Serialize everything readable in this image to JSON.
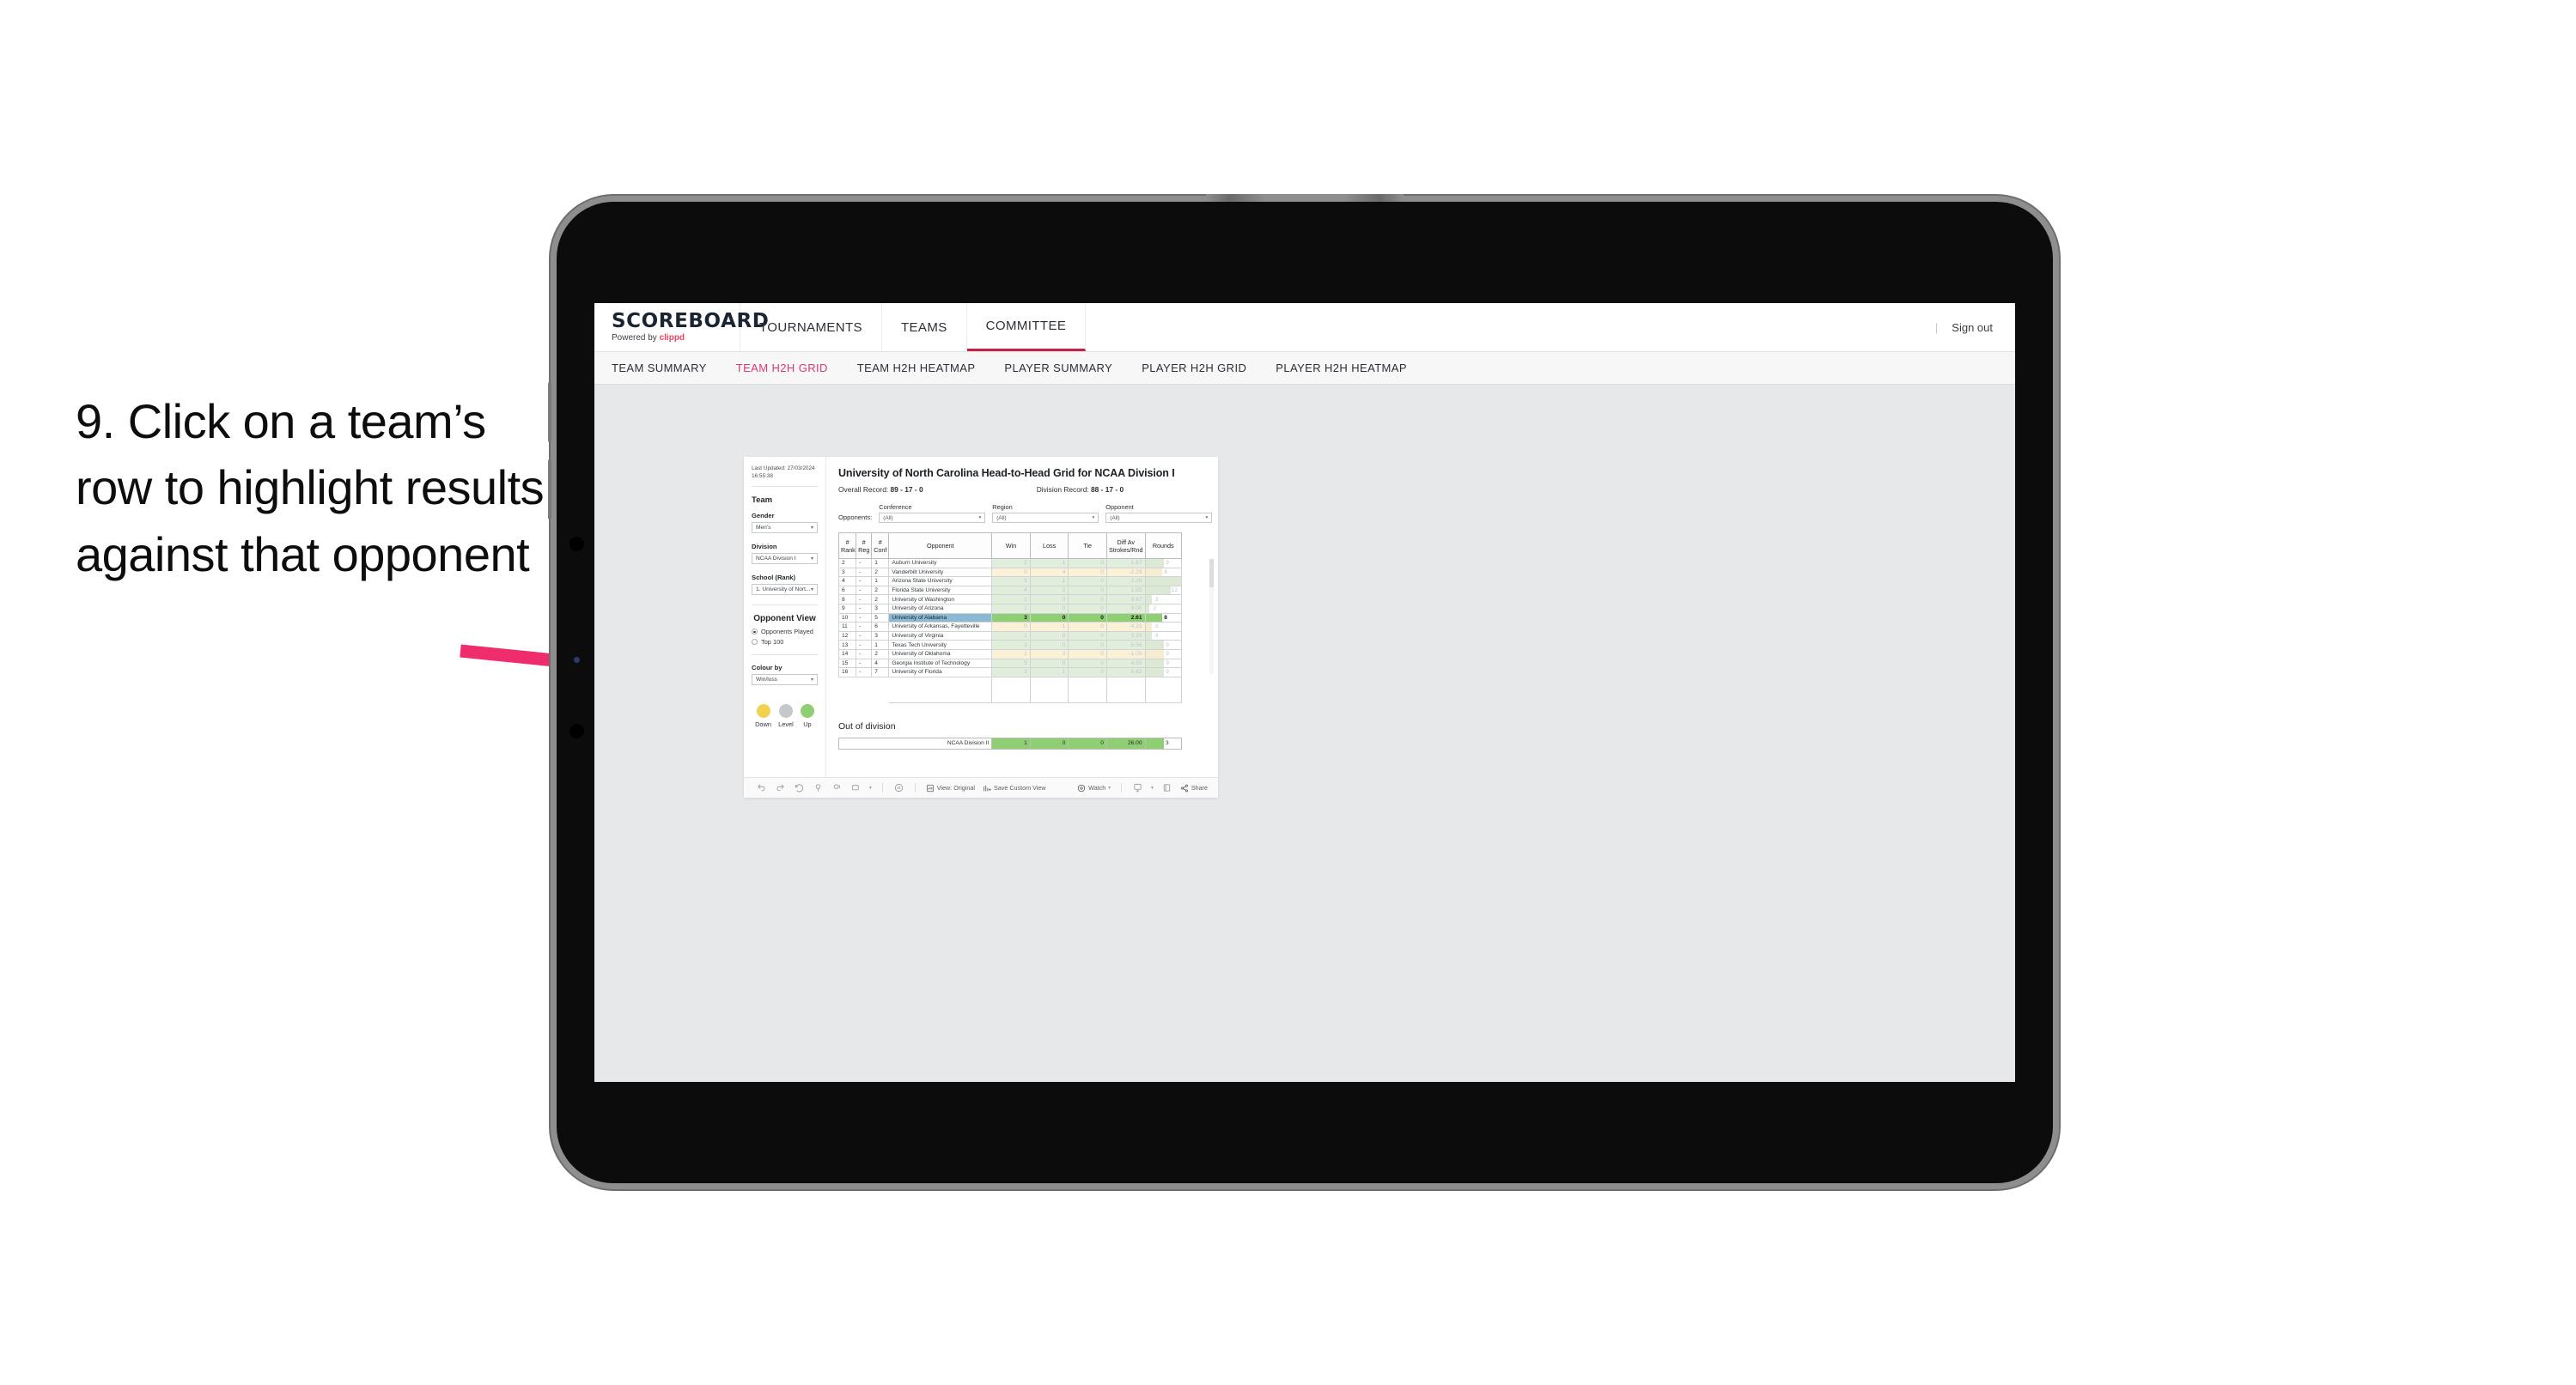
{
  "annotation": {
    "text": "9. Click on a team’s row to highlight results against that opponent",
    "arrow_color": "#ef2d6d"
  },
  "topnav": {
    "brand_title": "SCOREBOARD",
    "brand_sub_prefix": "Powered by ",
    "brand_sub_accent": "clippd",
    "items": [
      {
        "label": "TOURNAMENTS",
        "active": false
      },
      {
        "label": "TEAMS",
        "active": false
      },
      {
        "label": "COMMITTEE",
        "active": true
      }
    ],
    "divider": "|",
    "sign_out": "Sign out"
  },
  "subnav": {
    "items": [
      {
        "label": "TEAM SUMMARY",
        "active": false
      },
      {
        "label": "TEAM H2H GRID",
        "active": true
      },
      {
        "label": "TEAM H2H HEATMAP",
        "active": false
      },
      {
        "label": "PLAYER SUMMARY",
        "active": false
      },
      {
        "label": "PLAYER H2H GRID",
        "active": false
      },
      {
        "label": "PLAYER H2H HEATMAP",
        "active": false
      }
    ]
  },
  "sidebar": {
    "last_updated": "Last Updated: 27/03/2024 16:55:38",
    "team_title": "Team",
    "gender_label": "Gender",
    "gender_value": "Men’s",
    "division_label": "Division",
    "division_value": "NCAA Division I",
    "school_label": "School (Rank)",
    "school_value": "1. University of Nort...",
    "opponent_view_title": "Opponent View",
    "opponent_view_options": [
      {
        "label": "Opponents Played",
        "checked": true
      },
      {
        "label": "Top 100",
        "checked": false
      }
    ],
    "colour_by_label": "Colour by",
    "colour_by_value": "Win/loss",
    "legend": [
      {
        "label": "Down",
        "color": "#f2d14e"
      },
      {
        "label": "Level",
        "color": "#c4c8cb"
      },
      {
        "label": "Up",
        "color": "#8fce72"
      }
    ]
  },
  "main": {
    "title": "University of North Carolina Head-to-Head Grid for NCAA Division I",
    "overall_record_label": "Overall Record:",
    "overall_record_value": "89 - 17 - 0",
    "division_record_label": "Division Record:",
    "division_record_value": "88 - 17 - 0",
    "opponents_label": "Opponents:",
    "filters": [
      {
        "label": "Conference",
        "value": "(All)"
      },
      {
        "label": "Region",
        "value": "(All)"
      },
      {
        "label": "Opponent",
        "value": "(All)"
      }
    ],
    "out_of_division_title": "Out of division"
  },
  "chart_data": {
    "type": "table",
    "title": "University of North Carolina Head-to-Head Grid for NCAA Division I",
    "columns": [
      "# Rank",
      "# Reg",
      "# Conf",
      "Opponent",
      "Win",
      "Loss",
      "Tie",
      "Diff Av Strokes/Rnd",
      "Rounds"
    ],
    "rounds_max": 17,
    "rows": [
      {
        "rank": "2",
        "reg": "-",
        "conf": "1",
        "opponent": "Auburn University",
        "win": "2",
        "loss": "1",
        "tie": "0",
        "diff": "1.67",
        "rounds": "9",
        "state": "up",
        "selected": false
      },
      {
        "rank": "3",
        "reg": "-",
        "conf": "2",
        "opponent": "Vanderbilt University",
        "win": "0",
        "loss": "4",
        "tie": "0",
        "diff": "-2.29",
        "rounds": "8",
        "state": "down",
        "selected": false
      },
      {
        "rank": "4",
        "reg": "-",
        "conf": "1",
        "opponent": "Arizona State University",
        "win": "5",
        "loss": "1",
        "tie": "0",
        "diff": "2.28",
        "rounds": "17",
        "state": "up",
        "selected": false
      },
      {
        "rank": "6",
        "reg": "-",
        "conf": "2",
        "opponent": "Florida State University",
        "win": "4",
        "loss": "2",
        "tie": "0",
        "diff": "1.83",
        "rounds": "12",
        "state": "up",
        "selected": false
      },
      {
        "rank": "8",
        "reg": "-",
        "conf": "2",
        "opponent": "University of Washington",
        "win": "1",
        "loss": "0",
        "tie": "0",
        "diff": "3.67",
        "rounds": "3",
        "state": "up",
        "selected": false
      },
      {
        "rank": "9",
        "reg": "-",
        "conf": "3",
        "opponent": "University of Arizona",
        "win": "1",
        "loss": "0",
        "tie": "0",
        "diff": "9.00",
        "rounds": "2",
        "state": "up",
        "selected": false
      },
      {
        "rank": "10",
        "reg": "-",
        "conf": "5",
        "opponent": "University of Alabama",
        "win": "3",
        "loss": "0",
        "tie": "0",
        "diff": "2.61",
        "rounds": "8",
        "state": "up",
        "selected": true
      },
      {
        "rank": "11",
        "reg": "-",
        "conf": "6",
        "opponent": "University of Arkansas, Fayetteville",
        "win": "0",
        "loss": "1",
        "tie": "0",
        "diff": "-4.33",
        "rounds": "3",
        "state": "down",
        "selected": false
      },
      {
        "rank": "12",
        "reg": "-",
        "conf": "3",
        "opponent": "University of Virginia",
        "win": "1",
        "loss": "0",
        "tie": "0",
        "diff": "2.33",
        "rounds": "3",
        "state": "up",
        "selected": false
      },
      {
        "rank": "13",
        "reg": "-",
        "conf": "1",
        "opponent": "Texas Tech University",
        "win": "3",
        "loss": "0",
        "tie": "0",
        "diff": "5.56",
        "rounds": "9",
        "state": "up",
        "selected": false
      },
      {
        "rank": "14",
        "reg": "-",
        "conf": "2",
        "opponent": "University of Oklahoma",
        "win": "1",
        "loss": "2",
        "tie": "0",
        "diff": "-1.00",
        "rounds": "9",
        "state": "down",
        "selected": false
      },
      {
        "rank": "15",
        "reg": "-",
        "conf": "4",
        "opponent": "Georgia Institute of Technology",
        "win": "5",
        "loss": "0",
        "tie": "0",
        "diff": "4.50",
        "rounds": "9",
        "state": "up",
        "selected": false
      },
      {
        "rank": "16",
        "reg": "-",
        "conf": "7",
        "opponent": "University of Florida",
        "win": "3",
        "loss": "1",
        "tie": "0",
        "diff": "6.62",
        "rounds": "9",
        "state": "up",
        "selected": false
      }
    ],
    "out_of_division": [
      {
        "label": "NCAA Division II",
        "win": "1",
        "loss": "0",
        "tie": "0",
        "diff": "26.00",
        "rounds": "3"
      }
    ]
  },
  "toolbar": {
    "icons": [
      "undo-icon",
      "redo-icon",
      "revert-icon",
      "refresh-icon",
      "pause-icon",
      "device-layout-icon"
    ],
    "view_label": "View: Original",
    "save_custom_view_label": "Save Custom View",
    "watch_label": "Watch",
    "share_label": "Share"
  }
}
